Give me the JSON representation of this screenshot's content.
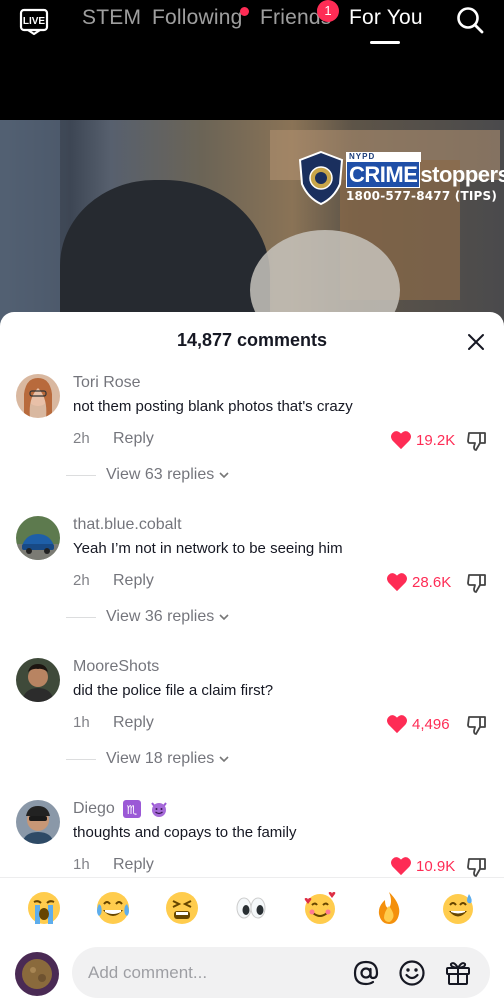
{
  "nav": {
    "live_label": "LIVE",
    "tabs": [
      {
        "label": "STEM"
      },
      {
        "label": "Following"
      },
      {
        "label": "Friends",
        "badge": "1"
      },
      {
        "label": "For You"
      }
    ],
    "active_tab": "For You"
  },
  "video": {
    "logo": {
      "nypd": "NYPD",
      "crime": "CRIME",
      "stoppers": "stoppers",
      "phone": "1800-577-8477 (TIPS)"
    }
  },
  "comments_panel": {
    "title": "14,877 comments",
    "comments": [
      {
        "user": "Tori Rose",
        "text": "not them posting blank photos that's crazy",
        "time": "2h",
        "reply_label": "Reply",
        "likes": "19.2K",
        "replies_label": "View 63 replies"
      },
      {
        "user": "that.blue.cobalt",
        "text": "Yeah I’m not in network to be seeing him",
        "time": "2h",
        "reply_label": "Reply",
        "likes": "28.6K",
        "replies_label": "View 36 replies"
      },
      {
        "user": "MooreShots",
        "text": "did the police file a claim first?",
        "time": "1h",
        "reply_label": "Reply",
        "likes": "4,496",
        "replies_label": "View 18 replies"
      },
      {
        "user": "Diego",
        "user_emojis": [
          "scorpio-icon",
          "smiling-devil-icon"
        ],
        "text": "thoughts and copays to the family",
        "time": "1h",
        "reply_label": "Reply",
        "likes": "10.9K"
      }
    ]
  },
  "emoji_bar": [
    "loudly-crying-face",
    "face-with-tears-of-joy",
    "tired-face",
    "eyes",
    "smiling-face-with-hearts",
    "fire",
    "grinning-face-with-sweat"
  ],
  "composer": {
    "placeholder": "Add comment...",
    "icons": [
      "mention-icon",
      "emoji-icon",
      "gift-icon"
    ]
  },
  "colors": {
    "accent": "#fe2c55",
    "text": "#161823",
    "panel_bg": "#ffffff",
    "input_bg": "#f1f1f2"
  }
}
